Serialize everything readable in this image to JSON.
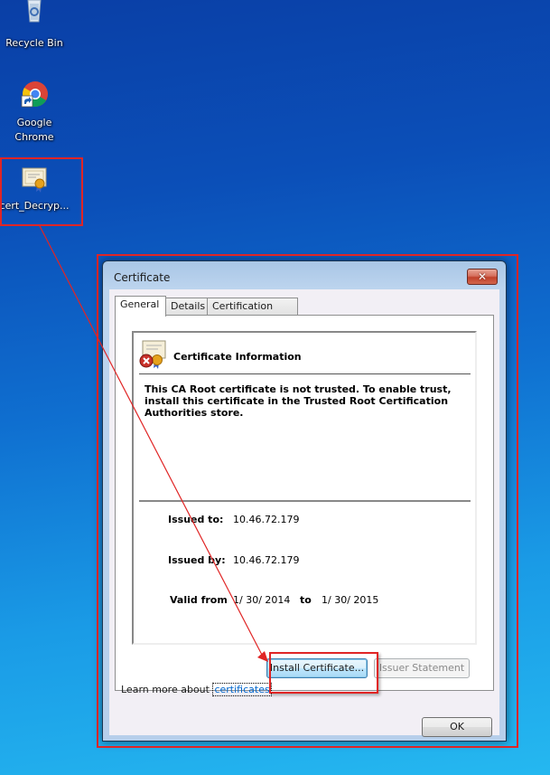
{
  "desktop": {
    "icons": [
      {
        "label": "Recycle Bin",
        "icon": "recycle-bin-icon"
      },
      {
        "label_line1": "Google",
        "label_line2": "Chrome",
        "icon": "chrome-icon"
      },
      {
        "label": "cert_Decryp...",
        "icon": "certificate-file-icon"
      }
    ]
  },
  "dialog": {
    "title": "Certificate",
    "close_label": "✕",
    "tabs": [
      {
        "label": "General",
        "active": true
      },
      {
        "label": "Details",
        "active": false
      },
      {
        "label": "Certification Path",
        "active": false
      }
    ],
    "info_title": "Certificate Information",
    "info_message": "This CA Root certificate is not trusted. To enable trust, install this certificate in the Trusted Root Certification Authorities store.",
    "fields": {
      "issued_to_label": "Issued to:",
      "issued_to_value": "10.46.72.179",
      "issued_by_label": "Issued by:",
      "issued_by_value": "10.46.72.179",
      "valid_from_label": "Valid from",
      "valid_from_value": "1/ 30/ 2014",
      "valid_to_label": "to",
      "valid_to_value": "1/ 30/ 2015"
    },
    "buttons": {
      "install": "Install Certificate...",
      "issuer_statement": "Issuer Statement",
      "ok": "OK"
    },
    "learn_more_prefix": "Learn more about",
    "learn_more_link": "certificates"
  },
  "colors": {
    "annotation": "#e02525",
    "link": "#0066cc"
  }
}
